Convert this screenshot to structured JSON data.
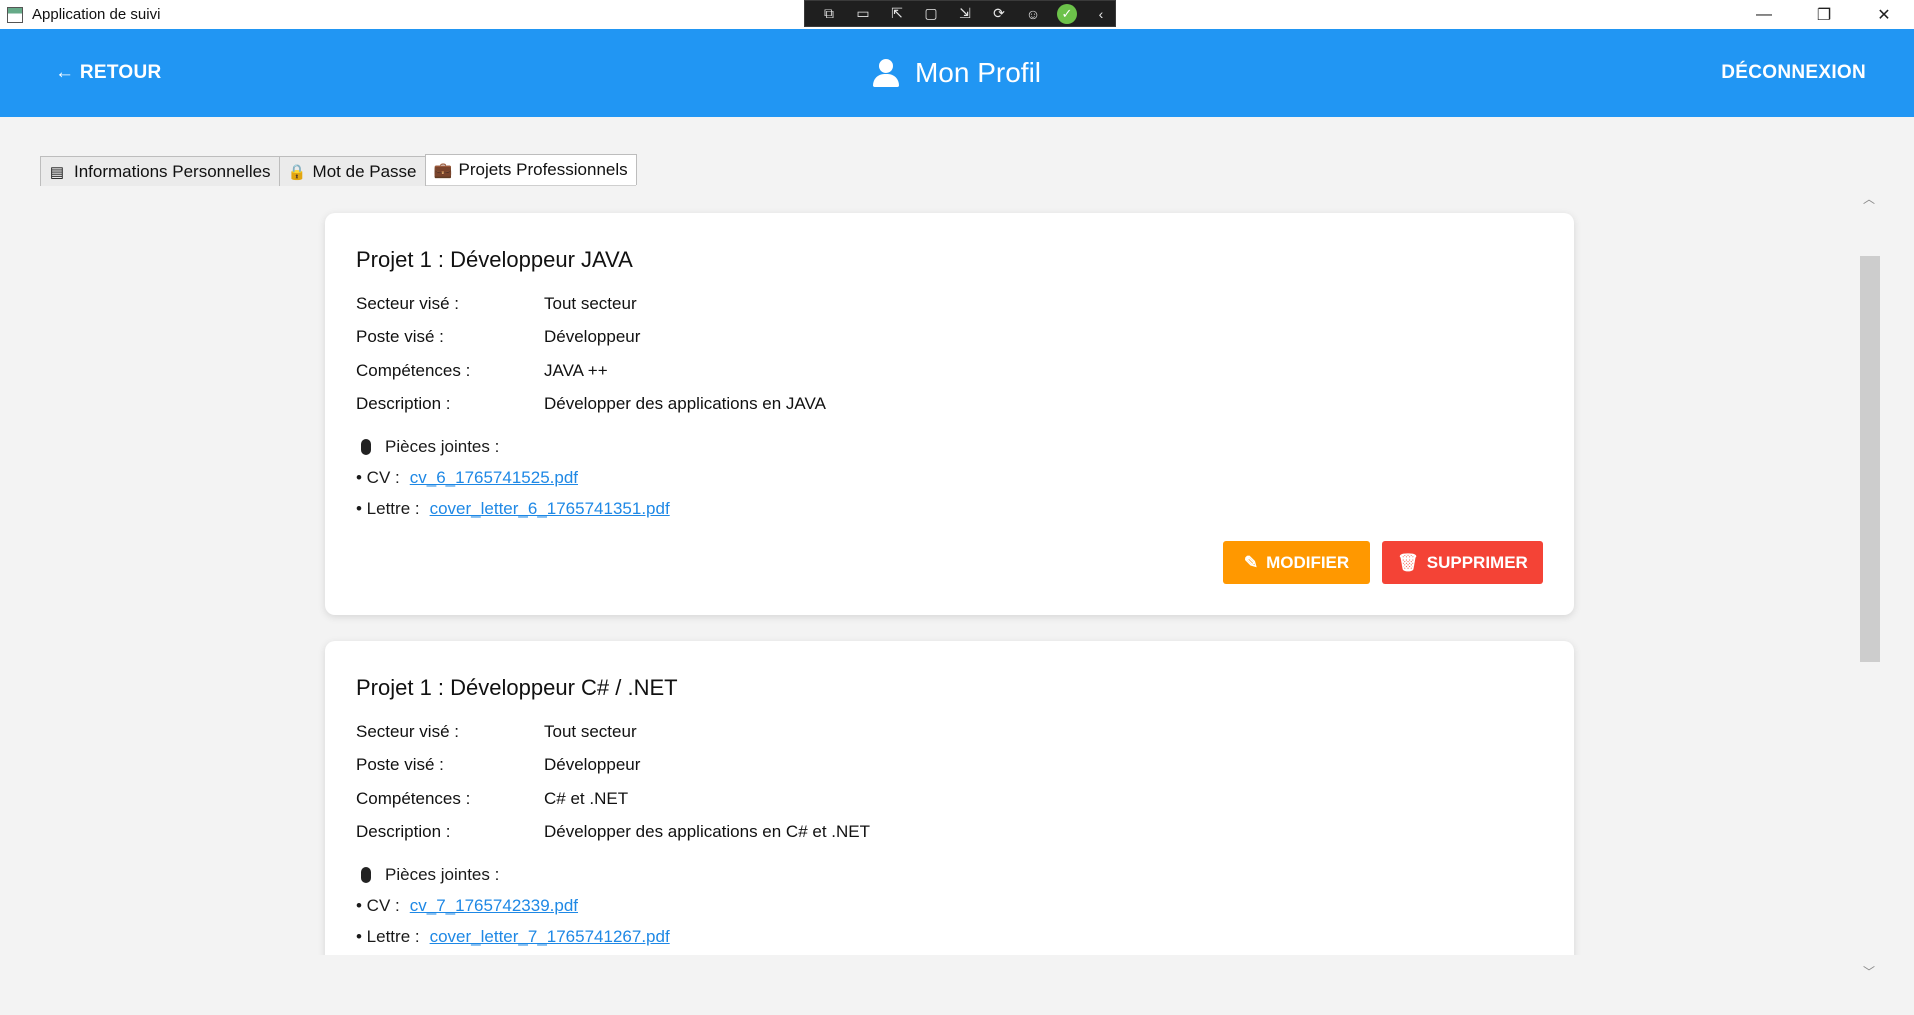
{
  "window": {
    "title": "Application de suivi",
    "minimize": "—",
    "restore": "❐",
    "close": "✕"
  },
  "debug_toolbar": {
    "icons": [
      "select-element-icon",
      "video-icon",
      "pointer-icon",
      "frame-icon",
      "adorner-icon",
      "hot-reload-icon",
      "accessibility-icon",
      "check-icon",
      "collapse-icon"
    ],
    "glyphs": [
      "⧉",
      "▭",
      "⇱",
      "▢",
      "⇲",
      "⟳",
      "☺",
      "✓",
      "‹"
    ]
  },
  "header": {
    "back_label": "← RETOUR",
    "title": "Mon Profil",
    "logout_label": "DÉCONNEXION",
    "background_color": "#2196f3"
  },
  "tabs": [
    {
      "label": "Informations Personnelles",
      "icon": "clipboard-icon",
      "glyph": "▤",
      "active": false
    },
    {
      "label": "Mot de Passe",
      "icon": "lock-icon",
      "glyph": "🔒",
      "active": false
    },
    {
      "label": "Projets Professionnels",
      "icon": "briefcase-icon",
      "glyph": "💼",
      "active": true
    }
  ],
  "projects": [
    {
      "title": "Projet 1 : Développeur JAVA",
      "fields": [
        {
          "label": "Secteur visé :",
          "value": "Tout secteur"
        },
        {
          "label": "Poste visé :",
          "value": "Développeur"
        },
        {
          "label": "Compétences :",
          "value": "JAVA ++"
        },
        {
          "label": "Description :",
          "value": "Développer des applications en JAVA"
        }
      ],
      "attachments_label": "Pièces jointes :",
      "cv_label": "• CV :",
      "cv_file": "cv_6_1765741525.pdf",
      "letter_label": "• Lettre :",
      "letter_file": "cover_letter_6_1765741351.pdf",
      "edit_label": "MODIFIER",
      "delete_label": "SUPPRIMER"
    },
    {
      "title": "Projet 1 : Développeur C# / .NET",
      "fields": [
        {
          "label": "Secteur visé :",
          "value": "Tout secteur"
        },
        {
          "label": "Poste visé :",
          "value": "Développeur"
        },
        {
          "label": "Compétences :",
          "value": "C# et .NET"
        },
        {
          "label": "Description :",
          "value": "Développer des applications en C# et .NET"
        }
      ],
      "attachments_label": "Pièces jointes :",
      "cv_label": "• CV :",
      "cv_file": "cv_7_1765742339.pdf",
      "letter_label": "• Lettre :",
      "letter_file": "cover_letter_7_1765741267.pdf"
    }
  ],
  "colors": {
    "accent": "#2196f3",
    "edit": "#ff9800",
    "delete": "#f44336",
    "link": "#1e88e5"
  }
}
